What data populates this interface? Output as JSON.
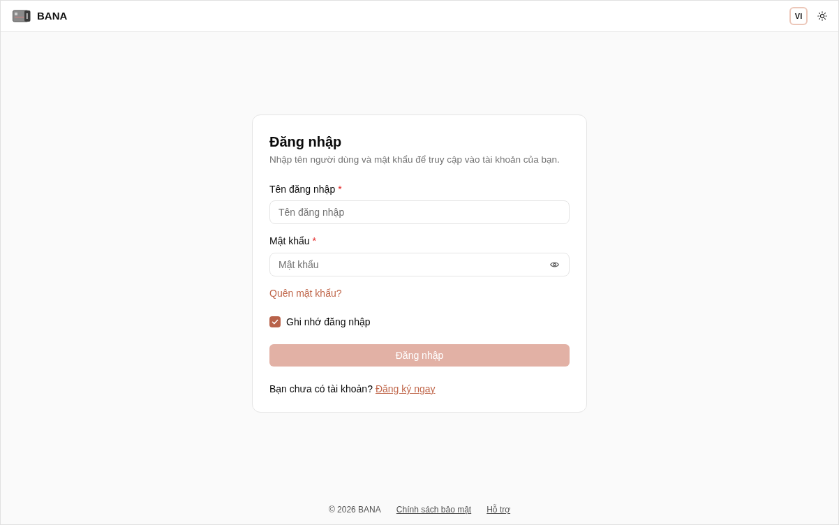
{
  "header": {
    "brand": "BANA",
    "language": "VI"
  },
  "login": {
    "title": "Đăng nhập",
    "description": "Nhập tên người dùng và mật khẩu để truy cập vào tài khoản của bạn.",
    "fields": [
      {
        "kind": "text",
        "label": "Tên đăng nhập",
        "required_mark": "*",
        "placeholder": "Tên đăng nhập"
      },
      {
        "kind": "password",
        "label": "Mật khẩu",
        "required_mark": "*",
        "placeholder": "Mật khẩu"
      }
    ],
    "forgot_link": "Quên mật khẩu?",
    "remember": {
      "label": "Ghi nhớ đăng nhập",
      "checked": true
    },
    "submit": {
      "label": "Đăng nhập",
      "disabled": true
    },
    "signup_prompt": "Bạn chưa có tài khoản?",
    "signup_link": "Đăng ký ngay"
  },
  "footer": {
    "copyright": "© 2026 BANA",
    "links": [
      "Chính sách bảo mật",
      "Hỗ trợ"
    ]
  }
}
